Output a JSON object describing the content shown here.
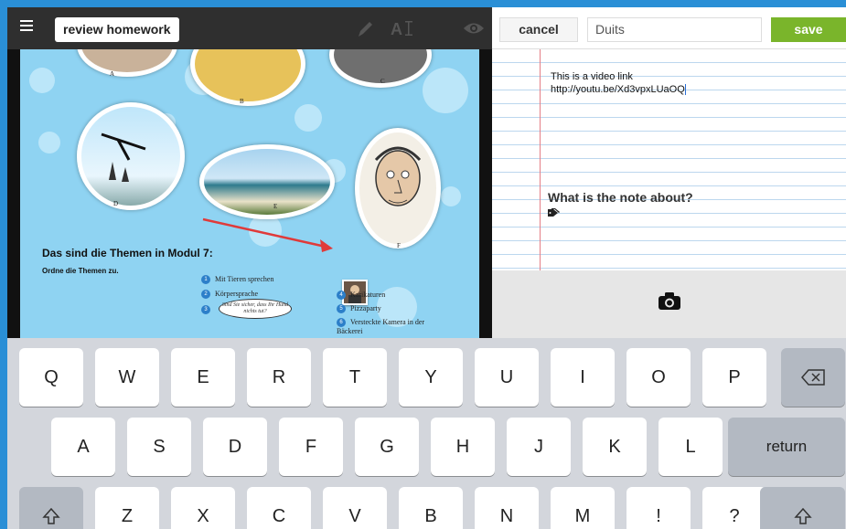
{
  "app": {
    "document_title": "review homework"
  },
  "textbook_page": {
    "heading": "Das sind die Themen in Modul 7:",
    "instruction": "Ordne die Themen zu.",
    "photo_labels": [
      "A",
      "B",
      "C",
      "D",
      "E",
      "F"
    ],
    "topics": [
      {
        "num": "1",
        "label": "Mit Tieren sprechen"
      },
      {
        "num": "2",
        "label": "Körpersprache"
      },
      {
        "num": "3",
        "label": ""
      },
      {
        "num": "4",
        "label": "Karikaturen"
      },
      {
        "num": "5",
        "label": "Pizzaparty"
      },
      {
        "num": "6",
        "label": "Versteckte Kamera in der Bäckerei"
      }
    ],
    "speech_bubble": "Sind Sie sicher, dass Ihr Hund nichts tut?"
  },
  "note_editor": {
    "cancel_label": "cancel",
    "title_value": "Duits",
    "save_label": "save",
    "body_line1": "This is a video link",
    "body_line2": "http://youtu.be/Xd3vpxLUaOQ",
    "about_prompt": "What is the note about?"
  },
  "keyboard": {
    "row1": [
      "Q",
      "W",
      "E",
      "R",
      "T",
      "Y",
      "U",
      "I",
      "O",
      "P"
    ],
    "row2": [
      "A",
      "S",
      "D",
      "F",
      "G",
      "H",
      "J",
      "K",
      "L"
    ],
    "row3": [
      "Z",
      "X",
      "C",
      "V",
      "B",
      "N",
      "M",
      "!",
      "?"
    ],
    "return_label": "return"
  },
  "colors": {
    "save_green": "#7ab52b",
    "page_blue": "#8fd3f2",
    "frame_blue": "#2a8fd6"
  },
  "icons": [
    "menu-icon",
    "pencil-icon",
    "text-size-icon",
    "eye-icon",
    "tag-icon",
    "camera-icon",
    "backspace-icon",
    "shift-icon"
  ]
}
